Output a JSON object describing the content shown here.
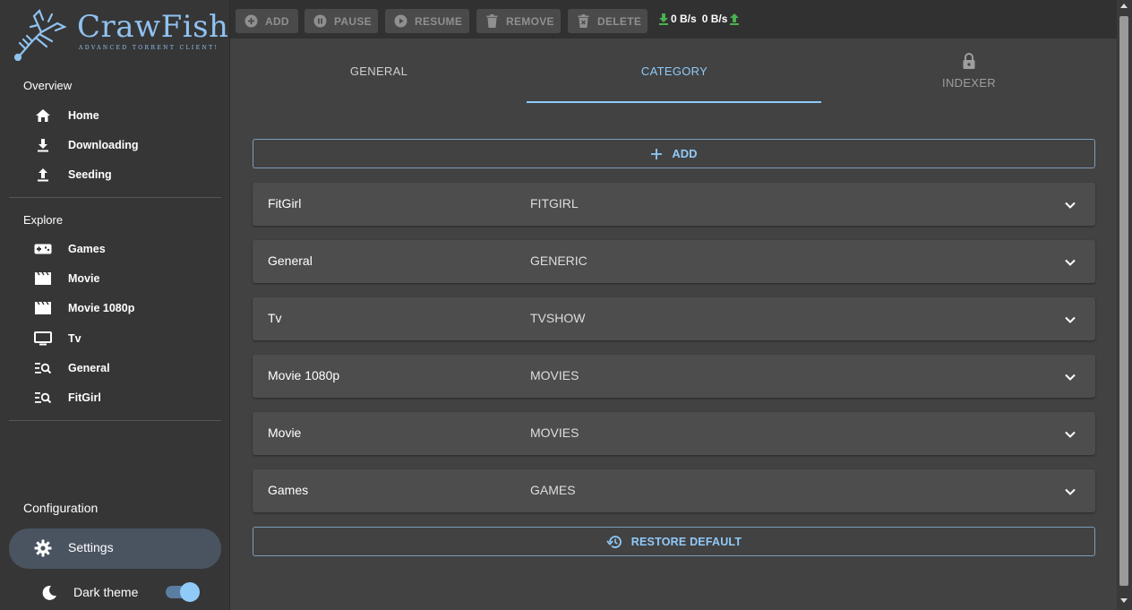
{
  "app": {
    "logo_title": "CrawFish",
    "logo_subtitle": "ADVANCED TORRENT CLIENT!"
  },
  "colors": {
    "accent": "#90caf9",
    "sidebar_bg": "#363636",
    "content_bg": "#424242",
    "row_bg": "#4d4d4d",
    "download_arrow": "#4caf50"
  },
  "sidebar": {
    "overview_title": "Overview",
    "overview_items": [
      {
        "label": "Home",
        "icon": "home-icon"
      },
      {
        "label": "Downloading",
        "icon": "download-icon"
      },
      {
        "label": "Seeding",
        "icon": "upload-icon"
      }
    ],
    "explore_title": "Explore",
    "explore_items": [
      {
        "label": "Games",
        "icon": "gamepad-icon"
      },
      {
        "label": "Movie",
        "icon": "movie-icon"
      },
      {
        "label": "Movie 1080p",
        "icon": "movie-icon"
      },
      {
        "label": "Tv",
        "icon": "tv-icon"
      },
      {
        "label": "General",
        "icon": "search-list-icon"
      },
      {
        "label": "FitGirl",
        "icon": "search-list-icon"
      }
    ],
    "configuration_title": "Configuration",
    "settings_label": "Settings",
    "dark_theme_label": "Dark theme",
    "dark_theme_on": true
  },
  "toolbar": {
    "add_label": "ADD",
    "pause_label": "PAUSE",
    "resume_label": "RESUME",
    "remove_label": "REMOVE",
    "delete_label": "DELETE",
    "download_speed": "0 B/s",
    "upload_speed": "0 B/s"
  },
  "tabs": [
    {
      "label": "GENERAL",
      "active": false
    },
    {
      "label": "CATEGORY",
      "active": true
    },
    {
      "label": "INDEXER",
      "active": false,
      "icon": "lock-icon"
    }
  ],
  "content": {
    "add_label": "ADD",
    "restore_label": "RESTORE DEFAULT",
    "rows": [
      {
        "name": "FitGirl",
        "category": "FITGIRL"
      },
      {
        "name": "General",
        "category": "GENERIC"
      },
      {
        "name": "Tv",
        "category": "TVSHOW"
      },
      {
        "name": "Movie 1080p",
        "category": "MOVIES"
      },
      {
        "name": "Movie",
        "category": "MOVIES"
      },
      {
        "name": "Games",
        "category": "GAMES"
      }
    ]
  }
}
